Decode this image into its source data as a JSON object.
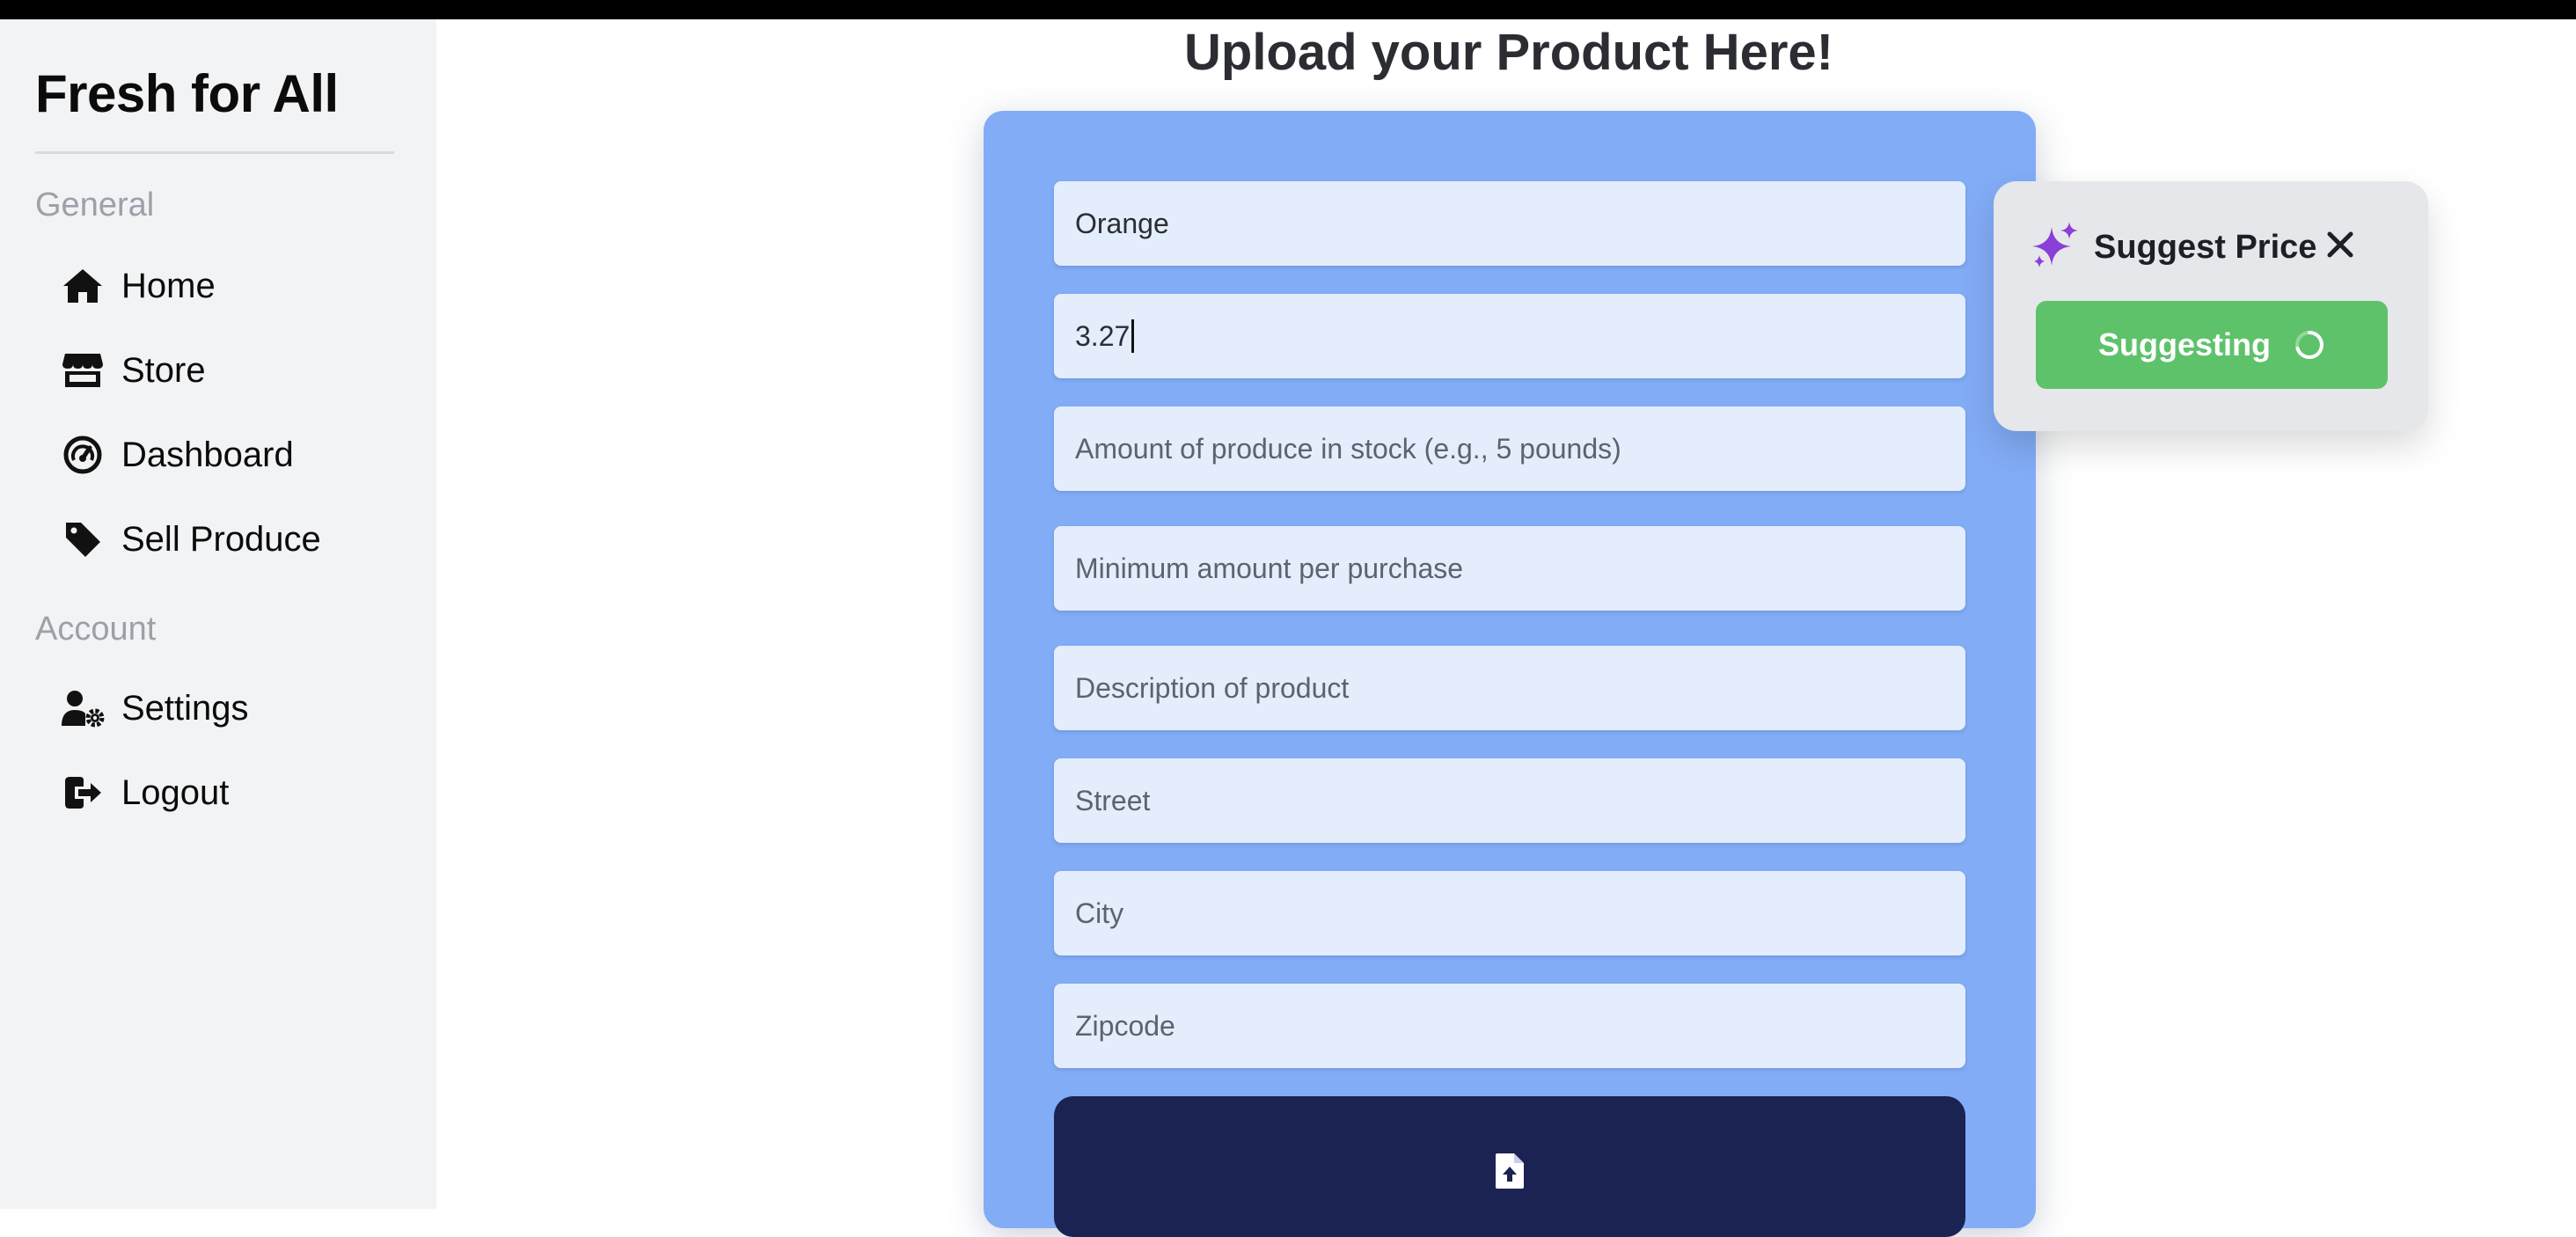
{
  "app": {
    "brand": "Fresh for All"
  },
  "sidebar": {
    "sections": [
      {
        "label": "General",
        "items": [
          {
            "label": "Home",
            "icon": "home-icon"
          },
          {
            "label": "Store",
            "icon": "store-icon"
          },
          {
            "label": "Dashboard",
            "icon": "dashboard-gauge-icon"
          },
          {
            "label": "Sell Produce",
            "icon": "tag-icon"
          }
        ]
      },
      {
        "label": "Account",
        "items": [
          {
            "label": "Settings",
            "icon": "user-gear-icon"
          },
          {
            "label": "Logout",
            "icon": "logout-icon"
          }
        ]
      }
    ]
  },
  "main": {
    "title": "Upload your Product Here!",
    "form": {
      "fields": [
        {
          "name": "product-name",
          "value": "Orange",
          "placeholder": ""
        },
        {
          "name": "price",
          "value": "3.27",
          "placeholder": ""
        },
        {
          "name": "stock-amount",
          "value": "",
          "placeholder": "Amount of produce in stock (e.g., 5 pounds)"
        },
        {
          "name": "min-purchase",
          "value": "",
          "placeholder": "Minimum amount per purchase"
        },
        {
          "name": "description",
          "value": "",
          "placeholder": "Description of product"
        },
        {
          "name": "street",
          "value": "",
          "placeholder": "Street"
        },
        {
          "name": "city",
          "value": "",
          "placeholder": "City"
        },
        {
          "name": "zipcode",
          "value": "",
          "placeholder": "Zipcode"
        }
      ],
      "upload_icon": "file-upload-icon"
    }
  },
  "suggest_price": {
    "title": "Suggest Price",
    "title_icon": "sparkles-icon",
    "close_icon": "close-icon",
    "button_label": "Suggesting",
    "button_icon": "spinner-icon"
  },
  "colors": {
    "sidebar_bg": "#f2f3f5",
    "form_card_bg": "#82acf6",
    "field_bg": "#e4edfc",
    "upload_bg": "#1b2352",
    "suggest_button_bg": "#5ec26a",
    "sparkle_accent": "#8a3fd6",
    "popover_bg": "#e6e7ea"
  }
}
